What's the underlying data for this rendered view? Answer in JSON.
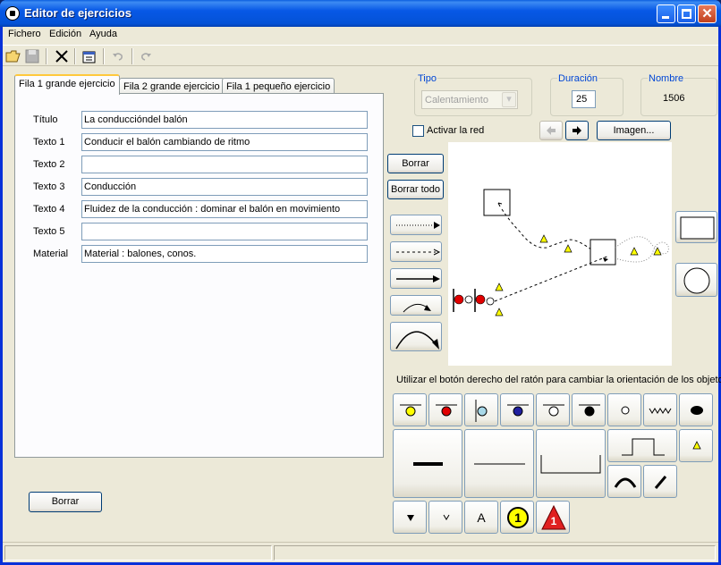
{
  "window": {
    "title": "Editor de ejercicios"
  },
  "menu": [
    "Fichero",
    "Edición",
    "Ayuda"
  ],
  "toolbar": {
    "open": "folder-open-icon",
    "save": "save-icon",
    "delete": "delete-x-icon",
    "properties": "properties-icon",
    "undo": "undo-icon",
    "redo": "redo-icon"
  },
  "tabs": [
    "Fila 1 grande ejercicio",
    "Fila 2 grande ejercicio",
    "Fila 1 pequeño ejercicio"
  ],
  "form": {
    "fields": [
      {
        "label": "Título",
        "value": "La conduccióndel balón"
      },
      {
        "label": "Texto 1",
        "value": "Conducir el balón cambiando de ritmo"
      },
      {
        "label": "Texto 2",
        "value": ""
      },
      {
        "label": "Texto 3",
        "value": "Conducción"
      },
      {
        "label": "Texto 4",
        "value": "Fluidez de la conducción : dominar el balón en movimiento"
      },
      {
        "label": "Texto 5",
        "value": ""
      },
      {
        "label": "Material",
        "value": "Material : balones, conos."
      }
    ]
  },
  "bottom_button": "Borrar",
  "tipo": {
    "label": "Tipo",
    "value": "Calentamiento"
  },
  "duracion": {
    "label": "Duración",
    "value": "25"
  },
  "nombre": {
    "label": "Nombre",
    "value": "1506"
  },
  "activar_red": {
    "label": "Activar la red",
    "checked": false
  },
  "imagen_button": "Imagen...",
  "borrar_button": "Borrar",
  "borrar_todo_button": "Borrar todo",
  "hint": "Utilizar el botón derecho del ratón para cambiar la orientación de los objetos.",
  "palette": {
    "text_a": "A",
    "num_yellow": "1",
    "num_red": "1"
  },
  "colors": {
    "tab_highlight": "#ffc83c",
    "group_label": "#0046d5",
    "cone": "#ffff00",
    "red_player": "#e00000",
    "blue_player": "#2020a0",
    "light_blue_player": "#a8d8e8"
  }
}
